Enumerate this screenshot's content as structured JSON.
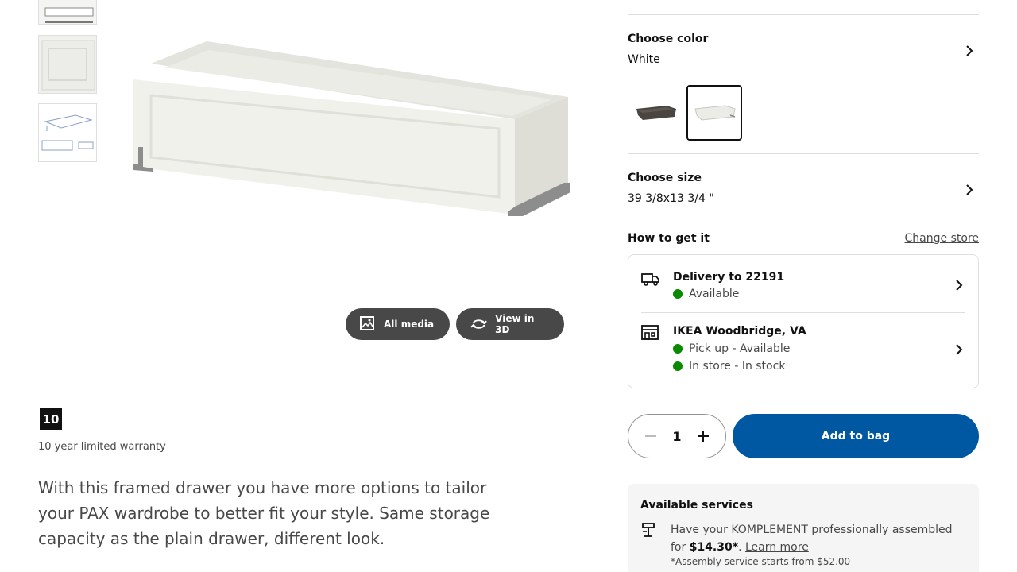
{
  "gallery": {
    "all_media_label": "All media",
    "view_3d_label": "View in 3D"
  },
  "warranty": {
    "badge": "10",
    "text": "10 year limited warranty"
  },
  "description": "With this framed drawer you have more options to tailor your PAX wardrobe to better fit your style. Same storage capacity as the plain drawer, different look.",
  "color": {
    "title": "Choose color",
    "value": "White",
    "swatches": [
      "dark-brown",
      "white"
    ],
    "selected": "white"
  },
  "size": {
    "title": "Choose size",
    "value": "39 3/8x13 3/4 \""
  },
  "get_it": {
    "title": "How to get it",
    "change_store": "Change store",
    "delivery": {
      "title": "Delivery to 22191",
      "status": "Available"
    },
    "store": {
      "title": "IKEA Woodbridge, VA",
      "status_1": "Pick up - Available",
      "status_2": "In store - In stock"
    }
  },
  "purchase": {
    "quantity": "1",
    "add_to_bag": "Add to bag"
  },
  "services": {
    "title": "Available services",
    "text_prefix": "Have your KOMPLEMENT professionally assembled for",
    "price": "$14.30*",
    "sep": ".",
    "link": "Learn more",
    "note": "*Assembly service starts from $52.00"
  },
  "colors": {
    "accent": "#0058a3",
    "button_dark": "#484848",
    "available": "#0a8a00"
  }
}
